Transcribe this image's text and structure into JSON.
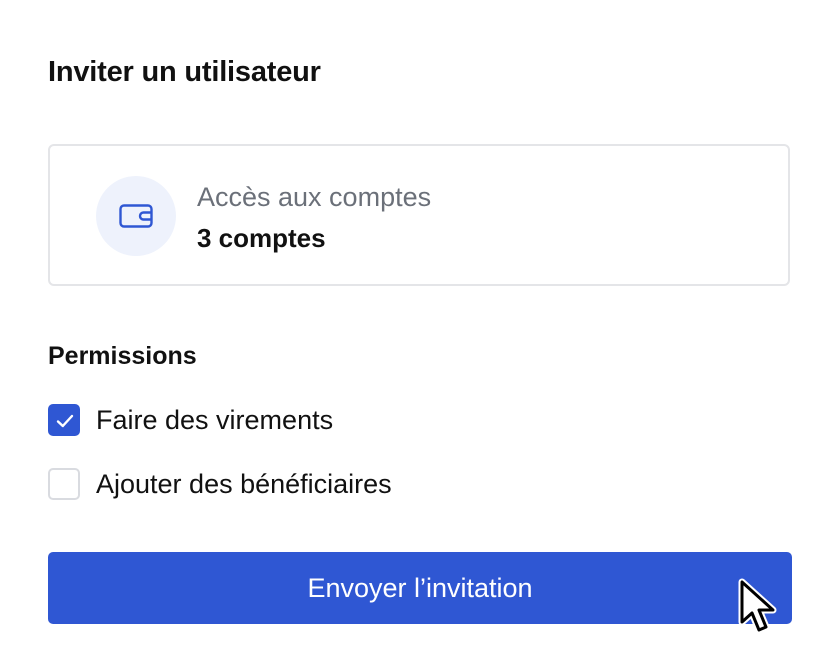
{
  "dialog": {
    "title": "Inviter un utilisateur"
  },
  "account_access": {
    "label": "Accès aux comptes",
    "value": "3 comptes",
    "icon": "wallet-icon"
  },
  "permissions": {
    "title": "Permissions",
    "items": [
      {
        "label": "Faire des virements",
        "checked": true
      },
      {
        "label": "Ajouter des bénéficiaires",
        "checked": false
      }
    ]
  },
  "actions": {
    "send_label": "Envoyer l’invitation"
  },
  "colors": {
    "accent": "#2f57d3",
    "icon_bg": "#eef2fc",
    "muted_text": "#6b7079",
    "border": "#e4e5e8"
  }
}
